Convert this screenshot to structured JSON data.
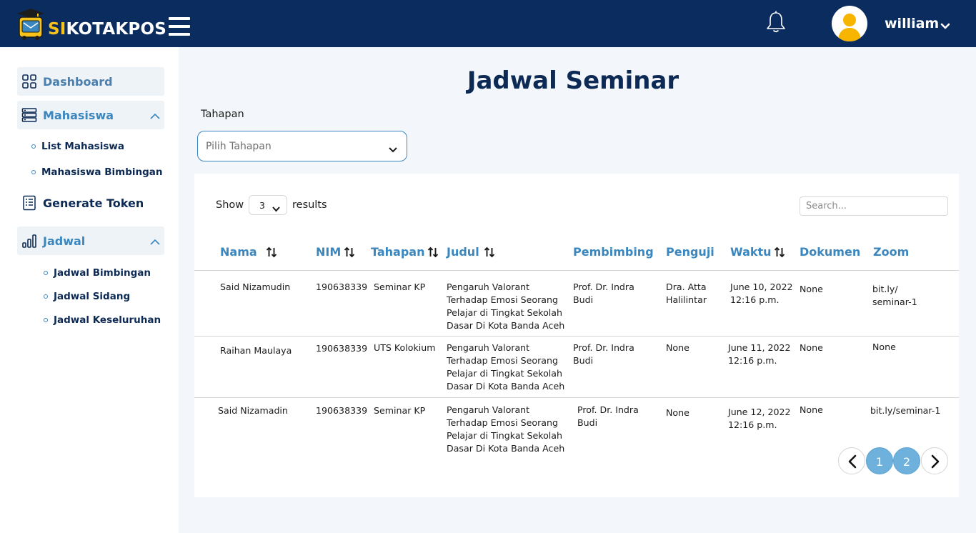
{
  "app": {
    "brand_prefix": "SI",
    "brand_suffix": "KOTAKPOS",
    "username": "william"
  },
  "sidebar": {
    "dashboard": "Dashboard",
    "mahasiswa": "Mahasiswa",
    "mahasiswa_sub": [
      "List Mahasiswa",
      "Mahasiswa Bimbingan"
    ],
    "generate_token": "Generate Token",
    "jadwal": "Jadwal",
    "jadwal_sub": [
      "Jadwal Bimbingan",
      "Jadwal Sidang",
      "Jadwal Keseluruhan"
    ]
  },
  "main": {
    "title": "Jadwal Seminar",
    "filter_label": "Tahapan",
    "filter_placeholder": "Pilih Tahapan",
    "show_label": "Show",
    "show_value": "3",
    "results_label": "results",
    "search_placeholder": "Search..."
  },
  "table": {
    "headers": [
      "Nama",
      "NIM",
      "Tahapan",
      "Judul",
      "Pembimbing",
      "Penguji",
      "Waktu",
      "Dokumen",
      "Zoom"
    ],
    "rows": [
      {
        "nama": "Said Nizamudin",
        "nim": "190638339",
        "tahapan": "Seminar KP",
        "judul": [
          "Pengaruh Valorant",
          "Terhadap Emosi Seorang",
          "Pelajar di Tingkat Sekolah",
          "Dasar Di Kota Banda Aceh"
        ],
        "pembimbing": [
          "Prof. Dr. Indra",
          "Budi"
        ],
        "penguji": [
          "Dra. Atta",
          "Halilintar"
        ],
        "waktu": [
          "June 10, 2022",
          "12:16 p.m."
        ],
        "dokumen": "None",
        "zoom": [
          "bit.ly/",
          "seminar-1"
        ]
      },
      {
        "nama": "Raihan Maulaya",
        "nim": "190638339",
        "tahapan": "UTS Kolokium",
        "judul": [
          "Pengaruh Valorant",
          "Terhadap Emosi Seorang",
          "Pelajar di Tingkat Sekolah",
          "Dasar Di Kota Banda Aceh"
        ],
        "pembimbing": [
          "Prof. Dr. Indra",
          "Budi"
        ],
        "penguji": [
          "None"
        ],
        "waktu": [
          "June 11, 2022",
          "12:16 p.m."
        ],
        "dokumen": "None",
        "zoom": [
          "None"
        ]
      },
      {
        "nama": "Said Nizamadin",
        "nim": "190638339",
        "tahapan": "Seminar KP",
        "judul": [
          "Pengaruh Valorant",
          "Terhadap Emosi Seorang",
          "Pelajar di Tingkat Sekolah",
          "Dasar Di Kota Banda Aceh"
        ],
        "pembimbing": [
          "Prof. Dr. Indra",
          "Budi"
        ],
        "penguji": [
          "None"
        ],
        "waktu": [
          "June 12, 2022",
          "12:16 p.m."
        ],
        "dokumen": "None",
        "zoom": [
          "bit.ly/seminar-1"
        ]
      }
    ]
  },
  "pagination": {
    "pages": [
      "1",
      "2"
    ]
  },
  "icons": {
    "logo": "bus-mail-icon",
    "menu": "hamburger-icon",
    "notifications": "bell-icon",
    "user": "user-avatar-icon",
    "dashboard": "grid-icon",
    "mahasiswa": "server-icon",
    "token": "document-list-icon",
    "jadwal": "bar-chart-icon",
    "sort": "sort-arrows-icon"
  },
  "colors": {
    "navy": "#0b2c5f",
    "accent": "#3a86bf",
    "brand_yellow": "#f7c31a",
    "page_bg": "#f3f6fa"
  }
}
